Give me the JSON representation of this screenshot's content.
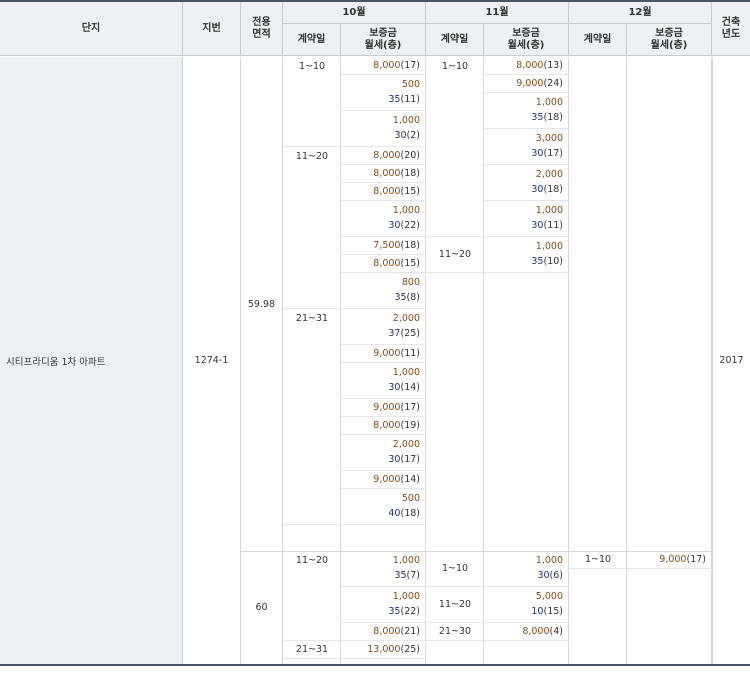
{
  "headers": {
    "complex": "단지",
    "lot": "지번",
    "area": "전용\n면적",
    "oct": "10월",
    "nov": "11월",
    "dec": "12월",
    "contract_day": "계약일",
    "deposit_rent": "보증금\n월세(층)",
    "built_year": "건축\n년도"
  },
  "complex_name": "시티프라디움 1차 아파트",
  "lot_number": "1274-1",
  "built_year": "2017",
  "groups": [
    {
      "area": "59.98",
      "months": [
        {
          "periods": [
            "1~10",
            "11~20",
            "21~31"
          ],
          "entries": [
            {
              "period": 0,
              "deposit": "8,000",
              "rent": "",
              "floor": "(17)"
            },
            {
              "period": 0,
              "deposit": "500",
              "rent": "35",
              "floor": "(11)"
            },
            {
              "period": 0,
              "deposit": "1,000",
              "rent": "30",
              "floor": "(2)"
            },
            {
              "period": 1,
              "deposit": "8,000",
              "rent": "",
              "floor": "(20)"
            },
            {
              "period": 1,
              "deposit": "8,000",
              "rent": "",
              "floor": "(18)"
            },
            {
              "period": 1,
              "deposit": "8,000",
              "rent": "",
              "floor": "(15)"
            },
            {
              "period": 1,
              "deposit": "1,000",
              "rent": "30",
              "floor": "(22)"
            },
            {
              "period": 1,
              "deposit": "7,500",
              "rent": "",
              "floor": "(18)"
            },
            {
              "period": 1,
              "deposit": "8,000",
              "rent": "",
              "floor": "(15)"
            },
            {
              "period": 1,
              "deposit": "800",
              "rent": "35",
              "floor": "(8)"
            },
            {
              "period": 2,
              "deposit": "2,000",
              "rent": "37",
              "floor": "(25)"
            },
            {
              "period": 2,
              "deposit": "9,000",
              "rent": "",
              "floor": "(11)"
            },
            {
              "period": 2,
              "deposit": "1,000",
              "rent": "30",
              "floor": "(14)"
            },
            {
              "period": 2,
              "deposit": "9,000",
              "rent": "",
              "floor": "(17)"
            },
            {
              "period": 2,
              "deposit": "8,000",
              "rent": "",
              "floor": "(19)"
            },
            {
              "period": 2,
              "deposit": "2,000",
              "rent": "30",
              "floor": "(17)"
            },
            {
              "period": 2,
              "deposit": "9,000",
              "rent": "",
              "floor": "(14)"
            },
            {
              "period": 2,
              "deposit": "500",
              "rent": "40",
              "floor": "(18)"
            }
          ]
        },
        {
          "periods": [
            "1~10",
            "11~20"
          ],
          "entries": [
            {
              "period": 0,
              "deposit": "8,000",
              "rent": "",
              "floor": "(13)"
            },
            {
              "period": 0,
              "deposit": "9,000",
              "rent": "",
              "floor": "(24)"
            },
            {
              "period": 0,
              "deposit": "1,000",
              "rent": "35",
              "floor": "(18)"
            },
            {
              "period": 0,
              "deposit": "3,000",
              "rent": "30",
              "floor": "(17)"
            },
            {
              "period": 0,
              "deposit": "2,000",
              "rent": "30",
              "floor": "(18)"
            },
            {
              "period": 0,
              "deposit": "1,000",
              "rent": "30",
              "floor": "(11)"
            },
            {
              "period": 1,
              "deposit": "1,000",
              "rent": "35",
              "floor": "(10)"
            }
          ]
        },
        {
          "periods": [],
          "entries": []
        }
      ]
    },
    {
      "area": "60",
      "months": [
        {
          "periods": [
            "11~20",
            "21~31"
          ],
          "entries": [
            {
              "period": 0,
              "deposit": "1,000",
              "rent": "35",
              "floor": "(7)"
            },
            {
              "period": 0,
              "deposit": "1,000",
              "rent": "35",
              "floor": "(22)"
            },
            {
              "period": 0,
              "deposit": "8,000",
              "rent": "",
              "floor": "(21)"
            },
            {
              "period": 1,
              "deposit": "13,000",
              "rent": "",
              "floor": "(25)"
            }
          ]
        },
        {
          "periods": [
            "1~10",
            "11~20",
            "21~30"
          ],
          "entries": [
            {
              "period": 0,
              "deposit": "1,000",
              "rent": "30",
              "floor": "(6)"
            },
            {
              "period": 1,
              "deposit": "5,000",
              "rent": "10",
              "floor": "(15)"
            },
            {
              "period": 2,
              "deposit": "8,000",
              "rent": "",
              "floor": "(4)"
            }
          ]
        },
        {
          "periods": [
            "1~10"
          ],
          "entries": [
            {
              "period": 0,
              "deposit": "9,000",
              "rent": "",
              "floor": "(17)"
            }
          ]
        }
      ]
    }
  ]
}
